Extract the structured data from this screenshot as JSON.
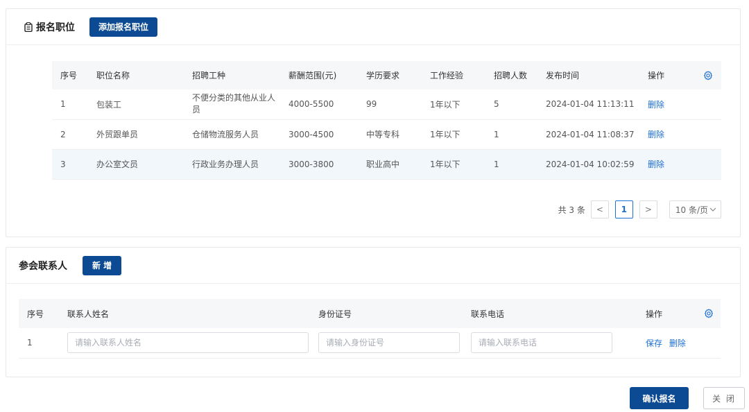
{
  "positions": {
    "title": "报名职位",
    "add_button": "添加报名职位",
    "columns": [
      "序号",
      "职位名称",
      "招聘工种",
      "薪酬范围(元)",
      "学历要求",
      "工作经验",
      "招聘人数",
      "发布时间",
      "操作"
    ],
    "rows": [
      {
        "index": "1",
        "name": "包装工",
        "type": "不便分类的其他从业人员",
        "salary": "4000-5500",
        "education": "99",
        "experience": "1年以下",
        "count": "5",
        "time": "2024-01-04 11:13:11",
        "action": "删除"
      },
      {
        "index": "2",
        "name": "外贸跟单员",
        "type": "仓储物流服务人员",
        "salary": "3000-4500",
        "education": "中等专科",
        "experience": "1年以下",
        "count": "1",
        "time": "2024-01-04 11:08:37",
        "action": "删除"
      },
      {
        "index": "3",
        "name": "办公室文员",
        "type": "行政业务办理人员",
        "salary": "3000-3800",
        "education": "职业高中",
        "experience": "1年以下",
        "count": "1",
        "time": "2024-01-04 10:02:59",
        "action": "删除"
      }
    ],
    "pagination": {
      "total": "共 3 条",
      "prev": "<",
      "page": "1",
      "next": ">",
      "page_size": "10 条/页"
    }
  },
  "contacts": {
    "title": "参会联系人",
    "add_button": "新 增",
    "columns": [
      "序号",
      "联系人姓名",
      "身份证号",
      "联系电话",
      "操作"
    ],
    "rows": [
      {
        "index": "1",
        "name_placeholder": "请输入联系人姓名",
        "id_placeholder": "请输入身份证号",
        "phone_placeholder": "请输入联系电话",
        "save": "保存",
        "delete": "删除"
      }
    ]
  },
  "footer": {
    "confirm": "确认报名",
    "close": "关 闭"
  },
  "colors": {
    "primary": "#0c4a94",
    "link": "#1d6fd1"
  }
}
